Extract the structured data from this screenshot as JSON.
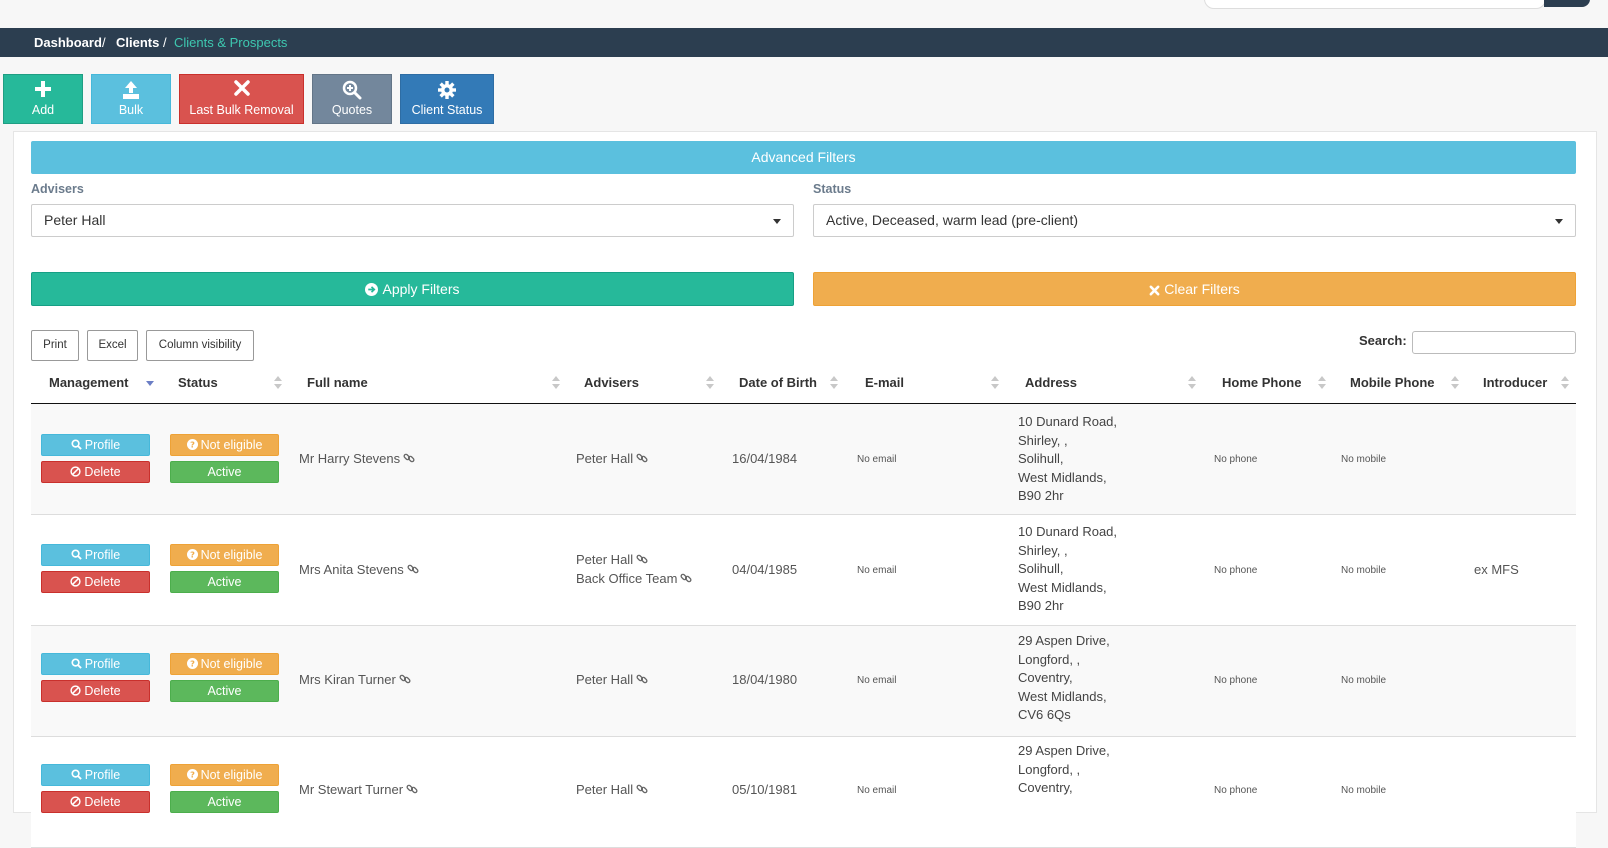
{
  "breadcrumb": {
    "items": [
      "Dashboard",
      "Clients",
      "Clients & Prospects"
    ],
    "separator": "/"
  },
  "toolbar": {
    "add": "Add",
    "bulk": "Bulk",
    "last_bulk_removal": "Last Bulk Removal",
    "quotes": "Quotes",
    "client_status": "Client Status"
  },
  "filters": {
    "title": "Advanced Filters",
    "advisers_label": "Advisers",
    "advisers_value": "Peter Hall",
    "status_label": "Status",
    "status_value": "Active, Deceased, warm lead (pre-client)",
    "apply": "Apply Filters",
    "clear": "Clear Filters"
  },
  "table_tools": {
    "print": "Print",
    "excel": "Excel",
    "column_visibility": "Column visibility",
    "search_label": "Search:"
  },
  "columns": [
    "Management",
    "Status",
    "Full name",
    "Advisers",
    "Date of Birth",
    "E-mail",
    "Address",
    "Home Phone",
    "Mobile Phone",
    "Introducer"
  ],
  "row_actions": {
    "profile": "Profile",
    "delete": "Delete",
    "not_eligible": "Not eligible",
    "active": "Active"
  },
  "rows": [
    {
      "name": "Mr Harry Stevens",
      "advisers": [
        "Peter Hall"
      ],
      "dob": "16/04/1984",
      "email": "No email",
      "address": [
        "10 Dunard Road,",
        "Shirley, ,",
        "Solihull,",
        "West Midlands,",
        "B90 2hr"
      ],
      "home_phone": "No phone",
      "mobile": "No mobile",
      "introducer": ""
    },
    {
      "name": "Mrs Anita Stevens",
      "advisers": [
        "Peter Hall",
        "Back Office Team"
      ],
      "dob": "04/04/1985",
      "email": "No email",
      "address": [
        "10 Dunard Road,",
        "Shirley, ,",
        "Solihull,",
        "West Midlands,",
        "B90 2hr"
      ],
      "home_phone": "No phone",
      "mobile": "No mobile",
      "introducer": "ex MFS"
    },
    {
      "name": "Mrs Kiran Turner",
      "advisers": [
        "Peter Hall"
      ],
      "dob": "18/04/1980",
      "email": "No email",
      "address": [
        "29 Aspen Drive,",
        "Longford, ,",
        "Coventry,",
        "West Midlands,",
        "CV6 6Qs"
      ],
      "home_phone": "No phone",
      "mobile": "No mobile",
      "introducer": ""
    },
    {
      "name": "Mr Stewart Turner",
      "advisers": [
        "Peter Hall"
      ],
      "dob": "05/10/1981",
      "email": "No email",
      "address": [
        "29 Aspen Drive,",
        "Longford, ,",
        "Coventry,"
      ],
      "home_phone": "No phone",
      "mobile": "No mobile",
      "introducer": ""
    }
  ],
  "colors": {
    "nav_dark": "#2c3e50",
    "breadcrumb_active": "#3ec8b0",
    "teal": "#26b99a",
    "info": "#5bc0de",
    "danger": "#d9534f",
    "slate": "#73879c",
    "primary": "#337ab7",
    "warning": "#f0ad4e",
    "success": "#5cb85c"
  },
  "icons": {
    "add": "plus-icon",
    "bulk": "upload-icon",
    "last_bulk_removal": "times-icon",
    "quotes": "search-plus-icon",
    "client_status": "gear-icon",
    "apply": "arrow-circle-right-icon",
    "clear": "times-icon",
    "profile": "search-icon",
    "delete": "ban-icon",
    "not_eligible": "question-circle-icon",
    "name_link": "link-icon"
  }
}
